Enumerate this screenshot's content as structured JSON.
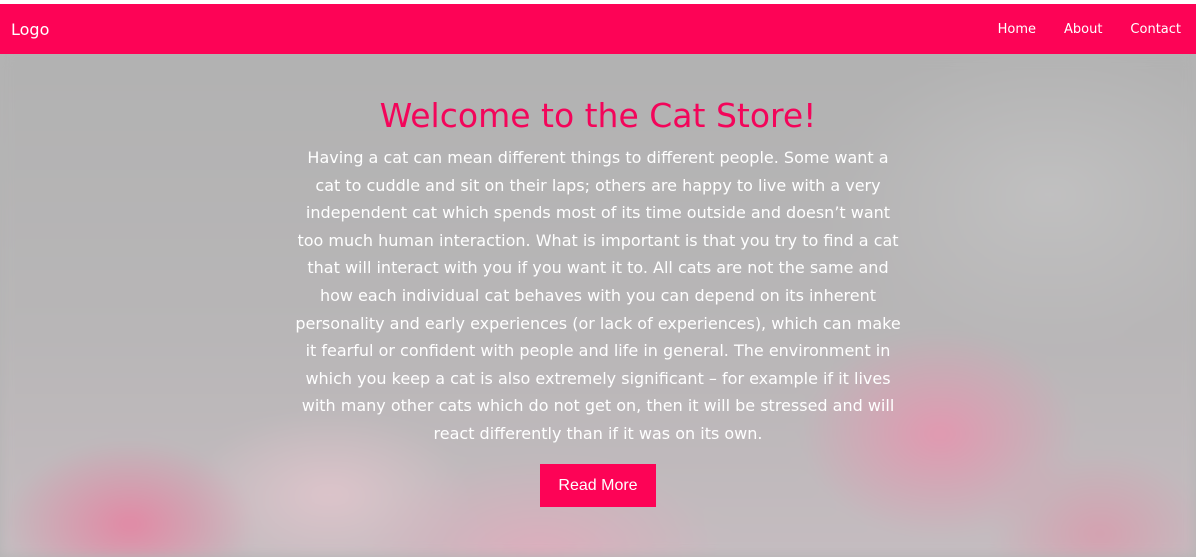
{
  "colors": {
    "accent": "#fd0356",
    "title": "#f3055a",
    "hero_text": "#ffffff"
  },
  "navbar": {
    "logo": "Logo",
    "links": [
      "Home",
      "About",
      "Contact"
    ]
  },
  "hero": {
    "title": "Welcome to the Cat Store!",
    "paragraph": "Having a cat can mean different things to different people. Some want a cat to cuddle and sit on their laps; others are happy to live with a very independent cat which spends most of its time outside and doesn’t want too much human interaction. What is important is that you try to find a cat that will interact with you if you want it to. All cats are not the same and how each individual cat behaves with you can depend on its inherent personality and early experiences (or lack of experiences), which can make it fearful or confident with people and life in general. The environment in which you keep a cat is also extremely significant – for example if it lives with many other cats which do not get on, then it will be stressed and will react differently than if it was on its own.",
    "button_label": "Read More"
  }
}
